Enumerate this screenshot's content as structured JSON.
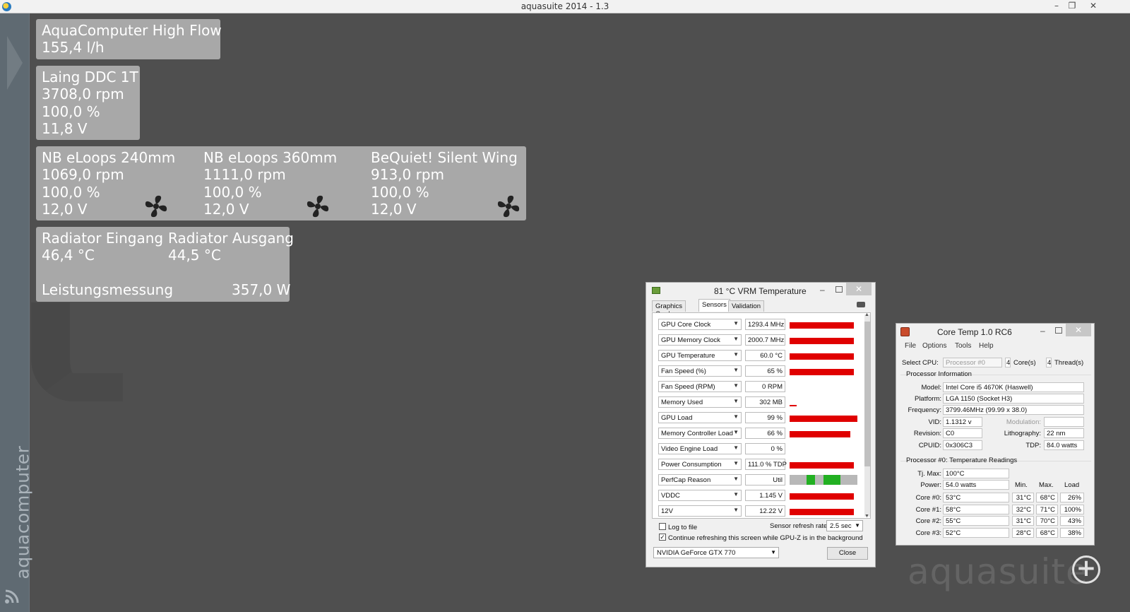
{
  "window": {
    "title": "aquasuite 2014 - 1.3",
    "minimize": "–",
    "restore": "❐",
    "close": "✕"
  },
  "sidebar": {
    "brand": "aquacomputer",
    "feed_icon": "rss-icon"
  },
  "watermark": "aquasuite",
  "add_button": "+",
  "panels": {
    "flow": {
      "name": "AquaComputer High Flow",
      "value": "155,4 l/h"
    },
    "pump": {
      "name": "Laing DDC 1T",
      "rpm": "3708,0 rpm",
      "percent": "100,0 %",
      "voltage": "11,8 V"
    },
    "fans": [
      {
        "name": "NB eLoops 240mm",
        "rpm": "1069,0 rpm",
        "percent": "100,0 %",
        "voltage": "12,0 V",
        "icon": "fan-icon"
      },
      {
        "name": "NB eLoops 360mm",
        "rpm": "1111,0 rpm",
        "percent": "100,0 %",
        "voltage": "12,0 V",
        "icon": "fan-icon"
      },
      {
        "name": "BeQuiet! Silent Wing",
        "rpm": "913,0 rpm",
        "percent": "100,0 %",
        "voltage": "12,0 V",
        "icon": "fan-icon"
      }
    ],
    "radiator": {
      "in_name": "Radiator Eingang",
      "in_value": "46,4 °C",
      "out_name": "Radiator Ausgang",
      "out_value": "44,5 °C",
      "power_name": "Leistungsmessung",
      "power_value": "357,0 W"
    }
  },
  "gpuz": {
    "title": "81 °C VRM Temperature",
    "tabs": [
      "Graphics Card",
      "Sensors",
      "Validation"
    ],
    "active_tab": "Sensors",
    "sensors": [
      {
        "name": "GPU Core Clock",
        "value": "1293.4 MHz",
        "level": 0.95
      },
      {
        "name": "GPU Memory Clock",
        "value": "2000.7 MHz",
        "level": 0.95
      },
      {
        "name": "GPU Temperature",
        "value": "60.0 °C",
        "level": 0.95
      },
      {
        "name": "Fan Speed (%)",
        "value": "65 %",
        "level": 0.95
      },
      {
        "name": "Fan Speed (RPM)",
        "value": "0 RPM",
        "level": 0.0
      },
      {
        "name": "Memory Used",
        "value": "302 MB",
        "level": 0.1
      },
      {
        "name": "GPU Load",
        "value": "99 %",
        "level": 1.0
      },
      {
        "name": "Memory Controller Load",
        "value": "66 %",
        "level": 0.9
      },
      {
        "name": "Video Engine Load",
        "value": "0 %",
        "level": 0.0
      },
      {
        "name": "Power Consumption",
        "value": "111.0 % TDP",
        "level": 0.95
      },
      {
        "name": "PerfCap Reason",
        "value": "Util",
        "level": -1
      },
      {
        "name": "VDDC",
        "value": "1.145 V",
        "level": 0.95
      },
      {
        "name": "12V",
        "value": "12.22 V",
        "level": 0.95
      }
    ],
    "log_to_file": "Log to file",
    "refresh_label": "Sensor refresh rate:",
    "refresh_value": "2.5 sec",
    "continue_label": "Continue refreshing this screen while GPU-Z is in the background",
    "gpu_select": "NVIDIA GeForce GTX 770",
    "close_button": "Close",
    "colors": {
      "bar": "#e00000",
      "perfcap_green": "#22b022",
      "perfcap_gray": "#b8b8b8"
    }
  },
  "coretemp": {
    "title": "Core Temp 1.0 RC6",
    "menu": [
      "File",
      "Options",
      "Tools",
      "Help"
    ],
    "select_cpu_label": "Select CPU:",
    "select_cpu_value": "Processor #0",
    "cores_count": "4",
    "cores_label": "Core(s)",
    "threads_count": "4",
    "threads_label": "Thread(s)",
    "proc_info_title": "Processor Information",
    "model_label": "Model:",
    "model": "Intel Core i5 4670K (Haswell)",
    "platform_label": "Platform:",
    "platform": "LGA 1150 (Socket H3)",
    "frequency_label": "Frequency:",
    "frequency": "3799.46MHz (99.99 x 38.0)",
    "vid_label": "VID:",
    "vid": "1.1312 v",
    "modulation_label": "Modulation:",
    "modulation": "",
    "revision_label": "Revision:",
    "revision": "C0",
    "lithography_label": "Lithography:",
    "lithography": "22 nm",
    "cpuid_label": "CPUID:",
    "cpuid": "0x306C3",
    "tdp_label": "TDP:",
    "tdp": "84.0 watts",
    "temp_title": "Processor #0: Temperature Readings",
    "tjmax_label": "Tj. Max:",
    "tjmax": "100°C",
    "power_label": "Power:",
    "power": "54.0 watts",
    "col_min": "Min.",
    "col_max": "Max.",
    "col_load": "Load",
    "cores": [
      {
        "label": "Core #0:",
        "temp": "53°C",
        "min": "31°C",
        "max": "68°C",
        "load": "26%"
      },
      {
        "label": "Core #1:",
        "temp": "58°C",
        "min": "32°C",
        "max": "71°C",
        "load": "100%"
      },
      {
        "label": "Core #2:",
        "temp": "55°C",
        "min": "31°C",
        "max": "70°C",
        "load": "43%"
      },
      {
        "label": "Core #3:",
        "temp": "52°C",
        "min": "28°C",
        "max": "68°C",
        "load": "38%"
      }
    ]
  }
}
